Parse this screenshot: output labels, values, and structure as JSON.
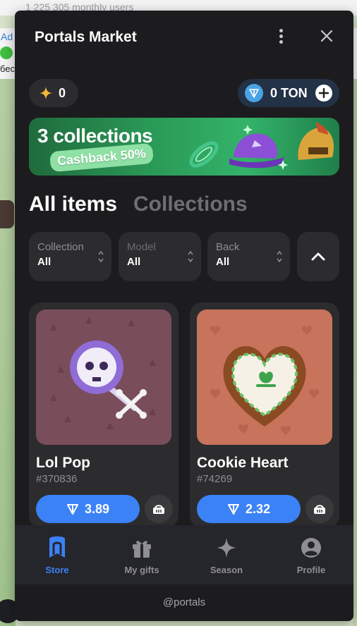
{
  "background": {
    "top_text": "1 225 305 monthly users",
    "ad_label": "Ad",
    "side_text": "бес"
  },
  "window": {
    "title": "Portals Market"
  },
  "balances": {
    "stars": "0",
    "ton": "0 TON"
  },
  "banner": {
    "title": "3 collections",
    "badge": "Cashback 50%"
  },
  "tabs": {
    "all_items": "All items",
    "collections": "Collections"
  },
  "filters": [
    {
      "label": "Collection",
      "value": "All"
    },
    {
      "label": "Model",
      "value": "All"
    },
    {
      "label": "Back",
      "value": "All"
    }
  ],
  "items": [
    {
      "name": "Lol Pop",
      "number": "#370836",
      "price": "3.89",
      "bg": "#7a4d5a"
    },
    {
      "name": "Cookie Heart",
      "number": "#74269",
      "price": "2.32",
      "bg": "#c8735c"
    }
  ],
  "tabbar": [
    {
      "label": "Store",
      "icon": "store-icon",
      "active": true
    },
    {
      "label": "My gifts",
      "icon": "gift-icon",
      "active": false
    },
    {
      "label": "Season",
      "icon": "sparkle-icon",
      "active": false
    },
    {
      "label": "Profile",
      "icon": "profile-icon",
      "active": false
    }
  ],
  "footer": {
    "handle": "@portals"
  },
  "colors": {
    "accent": "#3b82f6",
    "panel": "#1c1c1e",
    "card": "#2c2c2e"
  }
}
